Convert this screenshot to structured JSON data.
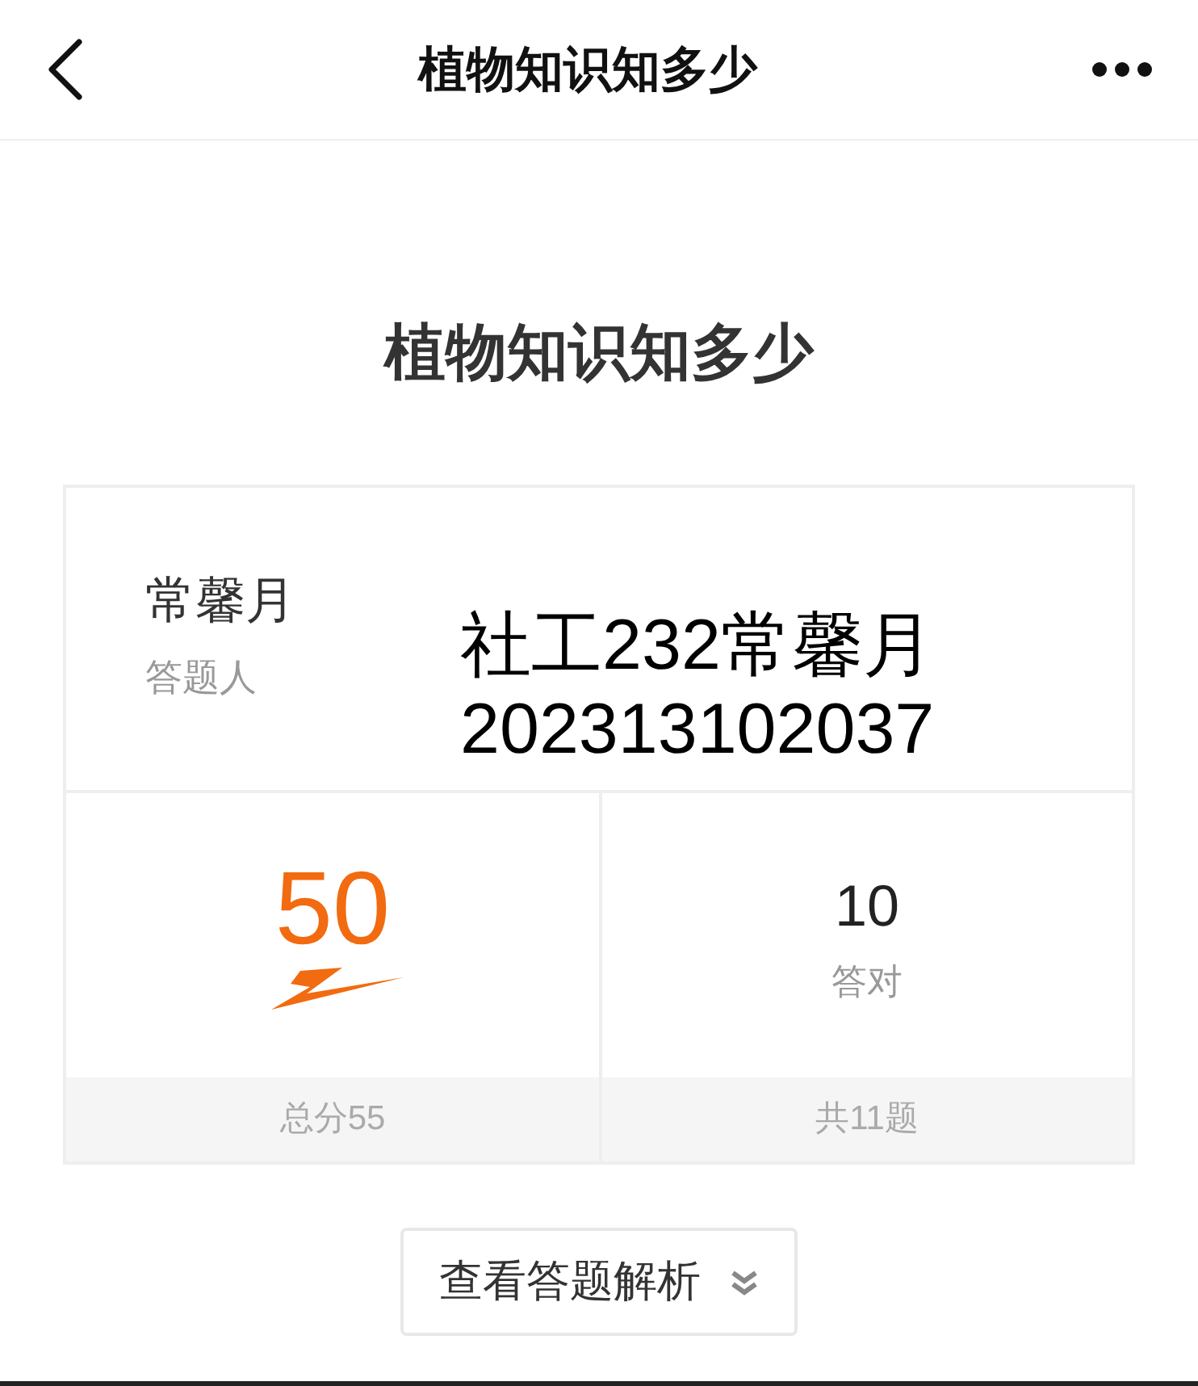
{
  "nav": {
    "title": "植物知识知多少"
  },
  "quiz_title": "植物知识知多少",
  "respondent": {
    "name": "常馨月",
    "label": "答题人",
    "note_lines": [
      "社工232常馨月",
      "202313102037"
    ]
  },
  "stats": [
    {
      "kind": "score",
      "value": "50",
      "footer": "总分55"
    },
    {
      "kind": "count",
      "value": "10",
      "label": "答对",
      "footer": "共11题"
    }
  ],
  "review_button": {
    "label": "查看答题解析"
  }
}
